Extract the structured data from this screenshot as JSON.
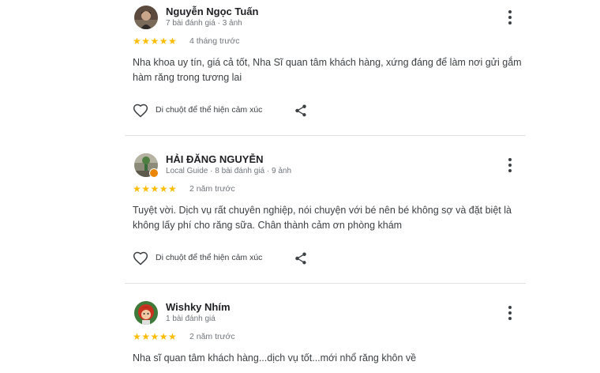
{
  "reviews": [
    {
      "name": "Nguyễn Ngọc Tuấn",
      "meta": "7 bài đánh giá · 3 ảnh",
      "stars": "★★★★★",
      "time": "4 tháng trước",
      "text": "Nha khoa uy tín, giá cả tốt, Nha Sĩ quan tâm khách hàng, xứng đáng để làm nơi gửi gắm hàm răng trong tương lai",
      "react_label": "Di chuột để thể hiện cảm xúc",
      "rating": 5
    },
    {
      "name": "HẢI ĐĂNG NGUYỄN",
      "meta": "Local Guide · 8 bài đánh giá · 9 ảnh",
      "stars": "★★★★★",
      "time": "2 năm trước",
      "text": "Tuyệt vời. Dịch vụ rất chuyên nghiệp, nói chuyện với bé nên bé không sợ và đặt biệt là không lấy phí cho răng sữa. Chân thành cảm ơn phòng khám",
      "react_label": "Di chuột để thể hiện cảm xúc",
      "rating": 5
    },
    {
      "name": "Wishky Nhím",
      "meta": "1 bài đánh giá",
      "stars": "★★★★★",
      "time": "2 năm trước",
      "text": "Nha sĩ quan tâm khách hàng...dịch vụ tốt...mới nhổ răng khôn về",
      "rating": 5
    }
  ],
  "colors": {
    "star": "#fbbc04",
    "local_guide_badge": "#ea8600",
    "divider": "#e0e0e0"
  },
  "icons": [
    "more-vert-icon",
    "heart-outline-icon",
    "share-icon",
    "local-guide-badge-icon"
  ]
}
